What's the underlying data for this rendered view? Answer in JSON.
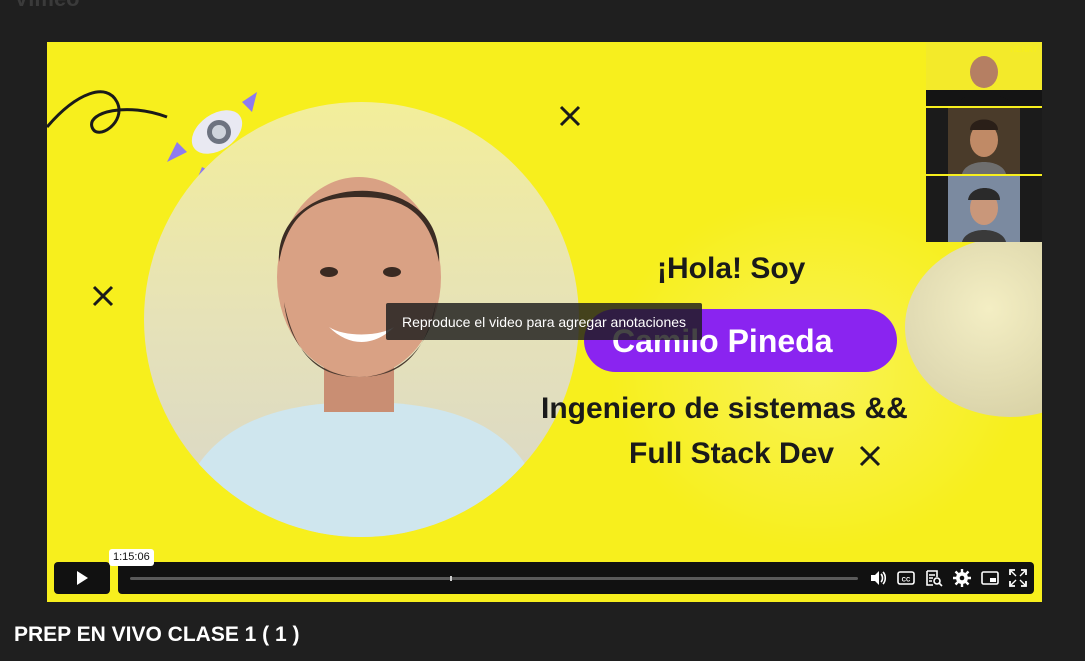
{
  "page": {
    "video_title": "PREP EN VIVO CLASE 1 ( 1 )"
  },
  "slide": {
    "greeting": "¡Hola! Soy",
    "name": "Camilo Pineda",
    "role_line1": "Ingeniero de sistemas &&",
    "role_line2": "Full Stack Dev",
    "colors": {
      "background": "#f7ef1d",
      "pill": "#8a24f0"
    }
  },
  "overlay": {
    "annotation_message": "Reproduce el video para agregar anotaciones"
  },
  "player": {
    "hover_time": "1:15:06",
    "hover_position": 0.44,
    "icons": [
      "play-icon",
      "volume-icon",
      "closed-captions-icon",
      "transcript-icon",
      "settings-icon",
      "picture-in-picture-icon",
      "fullscreen-icon"
    ]
  }
}
